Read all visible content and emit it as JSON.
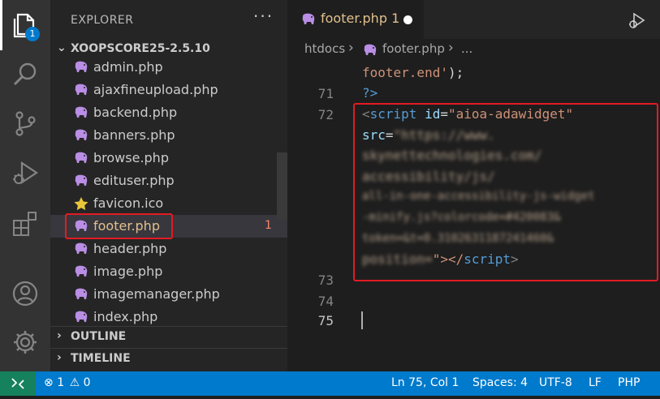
{
  "activity_bar": {
    "explorer_badge": "1",
    "icons": [
      "files-icon",
      "search-icon",
      "source-control-icon",
      "run-debug-icon",
      "extensions-icon",
      "account-icon",
      "gear-icon"
    ]
  },
  "sidebar": {
    "title": "EXPLORER",
    "more": "···",
    "folder": "XOOPSCORE25-2.5.10",
    "files": [
      {
        "name": "admin.php",
        "icon": "php-elephant-icon"
      },
      {
        "name": "ajaxfineupload.php",
        "icon": "php-elephant-icon"
      },
      {
        "name": "backend.php",
        "icon": "php-elephant-icon"
      },
      {
        "name": "banners.php",
        "icon": "php-elephant-icon"
      },
      {
        "name": "browse.php",
        "icon": "php-elephant-icon"
      },
      {
        "name": "edituser.php",
        "icon": "php-elephant-icon"
      },
      {
        "name": "favicon.ico",
        "icon": "star-icon"
      },
      {
        "name": "footer.php",
        "icon": "php-elephant-icon",
        "badge": "1",
        "selected": true
      },
      {
        "name": "header.php",
        "icon": "php-elephant-icon"
      },
      {
        "name": "image.php",
        "icon": "php-elephant-icon"
      },
      {
        "name": "imagemanager.php",
        "icon": "php-elephant-icon"
      },
      {
        "name": "index.php",
        "icon": "php-elephant-icon"
      }
    ],
    "outline": "OUTLINE",
    "timeline": "TIMELINE"
  },
  "editor": {
    "tab": {
      "name": "footer.php",
      "problems": "1"
    },
    "breadcrumb": {
      "folder": "htdocs",
      "sep": "›",
      "file": "footer.php",
      "rest": "..."
    },
    "lines": {
      "wrap_before": "footer.end');",
      "n71": "71",
      "l71": "?>",
      "n72": "72",
      "l72_tag_open": "<",
      "l72_tagname": "script",
      "l72_attr": "id",
      "l72_eq": "=",
      "l72_val": "\"aioa-adawidget\"",
      "l72b_attr": "src",
      "l72b_eq": "=",
      "blur1": "\"https://www.",
      "blur2": "skynettechnologies.com/",
      "blur3": "accessibility/js/",
      "blur4": "all-in-one-accessibility-js-widget",
      "blur5": "-minify.js?colorcode=#420083&",
      "blur6": "token=&t=0.3102631187241460&",
      "blur7": "position=",
      "l72_close": "\"></",
      "l72_close_name": "script",
      "l72_close_end": ">",
      "n73": "73",
      "n74": "74",
      "n75": "75"
    }
  },
  "status_bar": {
    "errors": "1",
    "warnings": "0",
    "position": "Ln 75, Col 1",
    "spaces": "Spaces: 4",
    "encoding": "UTF-8",
    "eol": "LF",
    "language": "PHP"
  },
  "colors": {
    "accent": "#007acc",
    "highlight": "#e31b23",
    "modified_file": "#e2c08d",
    "php_icon": "#b98ee4"
  }
}
